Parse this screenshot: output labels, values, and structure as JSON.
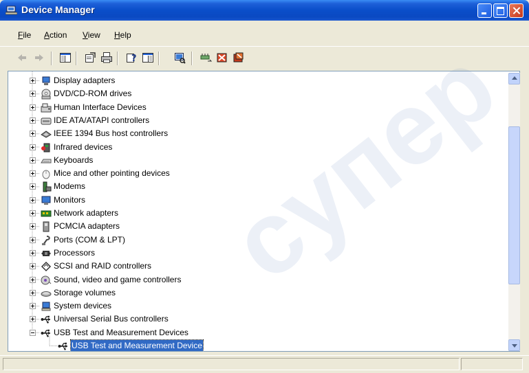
{
  "window": {
    "title": "Device Manager",
    "controls": {
      "minimize_icon": "minimize-icon",
      "maximize_icon": "maximize-icon",
      "close_icon": "close-icon"
    }
  },
  "menu": [
    {
      "label": "File"
    },
    {
      "label": "Action"
    },
    {
      "label": "View"
    },
    {
      "label": "Help"
    }
  ],
  "toolbar": [
    {
      "icon": "back-arrow-icon",
      "enabled": false
    },
    {
      "icon": "forward-arrow-icon",
      "enabled": false
    },
    {
      "icon": "show-hide-console-tree-icon",
      "enabled": true
    },
    {
      "icon": "properties-icon",
      "enabled": true
    },
    {
      "icon": "print-icon",
      "enabled": true
    },
    {
      "icon": "help-icon",
      "enabled": true
    },
    {
      "icon": "show-hide-action-pane-icon",
      "enabled": true
    },
    {
      "icon": "scan-hardware-changes-icon",
      "enabled": true
    },
    {
      "icon": "update-driver-icon",
      "enabled": true
    },
    {
      "icon": "disable-device-icon",
      "enabled": true
    },
    {
      "icon": "uninstall-device-icon",
      "enabled": true
    }
  ],
  "tree": {
    "nodes": [
      {
        "label": "Display adapters",
        "icon": "display-adapter-icon",
        "expanded": false
      },
      {
        "label": "DVD/CD-ROM drives",
        "icon": "dvd-drive-icon",
        "expanded": false
      },
      {
        "label": "Human Interface Devices",
        "icon": "hid-icon",
        "expanded": false
      },
      {
        "label": "IDE ATA/ATAPI controllers",
        "icon": "ide-controller-icon",
        "expanded": false
      },
      {
        "label": "IEEE 1394 Bus host controllers",
        "icon": "ieee1394-icon",
        "expanded": false
      },
      {
        "label": "Infrared devices",
        "icon": "infrared-icon",
        "expanded": false
      },
      {
        "label": "Keyboards",
        "icon": "keyboard-icon",
        "expanded": false
      },
      {
        "label": "Mice and other pointing devices",
        "icon": "mouse-icon",
        "expanded": false
      },
      {
        "label": "Modems",
        "icon": "modem-icon",
        "expanded": false
      },
      {
        "label": "Monitors",
        "icon": "monitor-icon",
        "expanded": false
      },
      {
        "label": "Network adapters",
        "icon": "network-adapter-icon",
        "expanded": false
      },
      {
        "label": "PCMCIA adapters",
        "icon": "pcmcia-icon",
        "expanded": false
      },
      {
        "label": "Ports (COM & LPT)",
        "icon": "port-icon",
        "expanded": false
      },
      {
        "label": "Processors",
        "icon": "processor-icon",
        "expanded": false
      },
      {
        "label": "SCSI and RAID controllers",
        "icon": "scsi-icon",
        "expanded": false
      },
      {
        "label": "Sound, video and game controllers",
        "icon": "sound-icon",
        "expanded": false
      },
      {
        "label": "Storage volumes",
        "icon": "storage-volume-icon",
        "expanded": false
      },
      {
        "label": "System devices",
        "icon": "system-device-icon",
        "expanded": false
      },
      {
        "label": "Universal Serial Bus controllers",
        "icon": "usb-icon",
        "expanded": false
      },
      {
        "label": "USB Test and Measurement Devices",
        "icon": "usb-icon",
        "expanded": true,
        "children": [
          {
            "label": "USB Test and Measurement Device",
            "icon": "usb-icon",
            "selected": true
          }
        ]
      }
    ]
  },
  "watermark": {
    "text": "супер"
  },
  "colors": {
    "selection": "#316ac5",
    "titlebar": "#0a4ec9",
    "window_bg": "#ece9d8"
  }
}
